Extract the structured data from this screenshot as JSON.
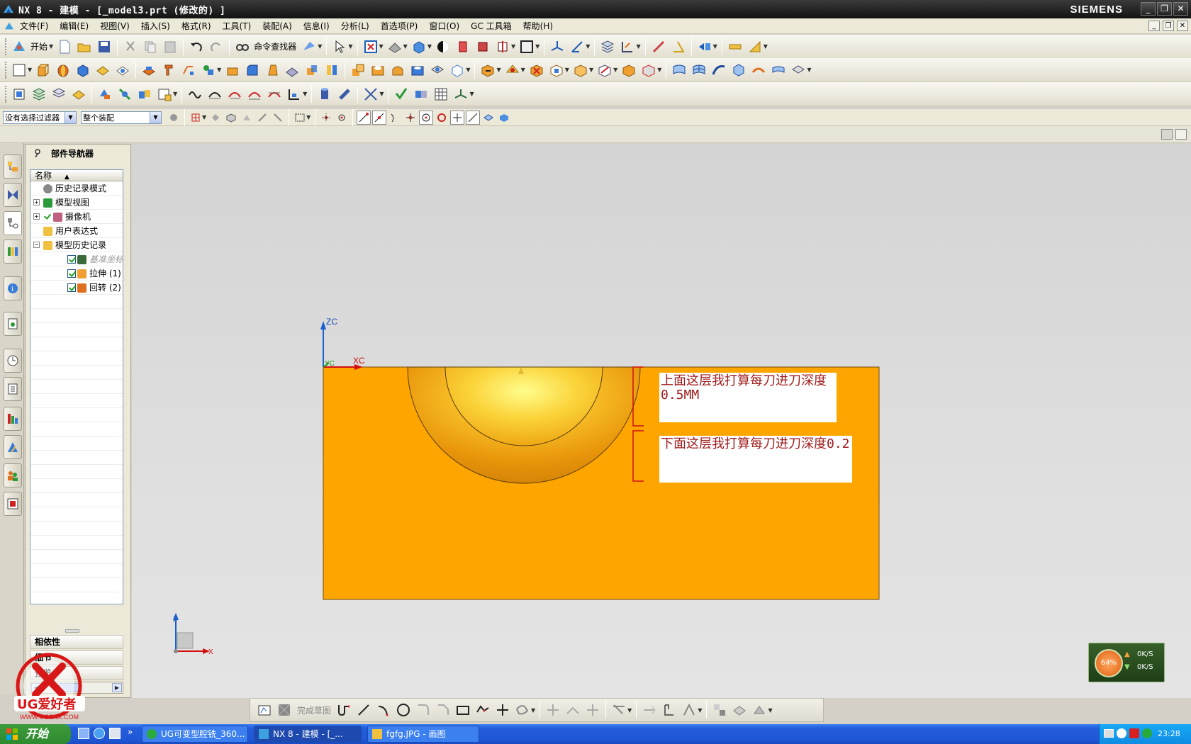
{
  "window": {
    "title": "NX 8 - 建模 - [_model3.prt (修改的) ]",
    "brand": "SIEMENS",
    "controls": [
      "_",
      "❐",
      "✕"
    ]
  },
  "menu": {
    "items": [
      "文件(F)",
      "编辑(E)",
      "视图(V)",
      "插入(S)",
      "格式(R)",
      "工具(T)",
      "装配(A)",
      "信息(I)",
      "分析(L)",
      "首选项(P)",
      "窗口(O)",
      "GC 工具箱",
      "帮助(H)"
    ]
  },
  "toolbar": {
    "start_label": "开始",
    "command_finder_label": "命令查找器"
  },
  "selection_bar": {
    "filter_value": "没有选择过滤器",
    "scope_value": "整个装配"
  },
  "navigator": {
    "title": "部件导航器",
    "column_header": "名称",
    "sort_indicator": "▲",
    "tree": [
      {
        "label": "历史记录模式",
        "icon": "clock-icon",
        "level": 0,
        "expander": "",
        "checked": false
      },
      {
        "label": "模型视图",
        "icon": "model-views-icon",
        "level": 0,
        "expander": "+",
        "checked": false
      },
      {
        "label": "摄像机",
        "icon": "camera-icon",
        "level": 0,
        "expander": "+",
        "checked": true
      },
      {
        "label": "用户表达式",
        "icon": "folder-icon",
        "level": 0,
        "expander": "",
        "checked": false
      },
      {
        "label": "模型历史记录",
        "icon": "folder-open-icon",
        "level": 0,
        "expander": "−",
        "checked": false
      },
      {
        "label": "基准坐标系",
        "icon": "datum-csys-icon",
        "level": 1,
        "expander": "",
        "checked": true,
        "grey": true
      },
      {
        "label": "拉伸 (1)",
        "icon": "extrude-icon",
        "level": 1,
        "expander": "",
        "checked": true
      },
      {
        "label": "回转 (2)",
        "icon": "revolve-icon",
        "level": 1,
        "expander": "",
        "checked": true
      }
    ],
    "panels": [
      "相依性",
      "细节",
      "预览"
    ]
  },
  "graphics": {
    "axis_labels": {
      "zc": "ZC",
      "xc": "XC",
      "yc": "YC"
    },
    "triad_labels": {
      "z": "Z",
      "x": "X"
    },
    "notes": [
      "上面这层我打算每刀进刀深度0.5MM",
      "下面这层我打算每刀进刀深度0.2"
    ],
    "part_color": "#ffa500",
    "note_color": "#a11c1c"
  },
  "network_widget": {
    "percent": "64%",
    "up": "0K/S",
    "down": "0K/S"
  },
  "sketch_toolbar": {
    "finish_label": "完成草图"
  },
  "taskbar": {
    "start_label": "开始",
    "tasks": [
      "UG可变型腔铣_360...",
      "NX 8 - 建模 - [_...",
      "fgfg.JPG - 画图"
    ],
    "clock": "23:28"
  },
  "watermark": {
    "brand": "UG爱好者",
    "url": "WWW.UGSNX.COM"
  }
}
